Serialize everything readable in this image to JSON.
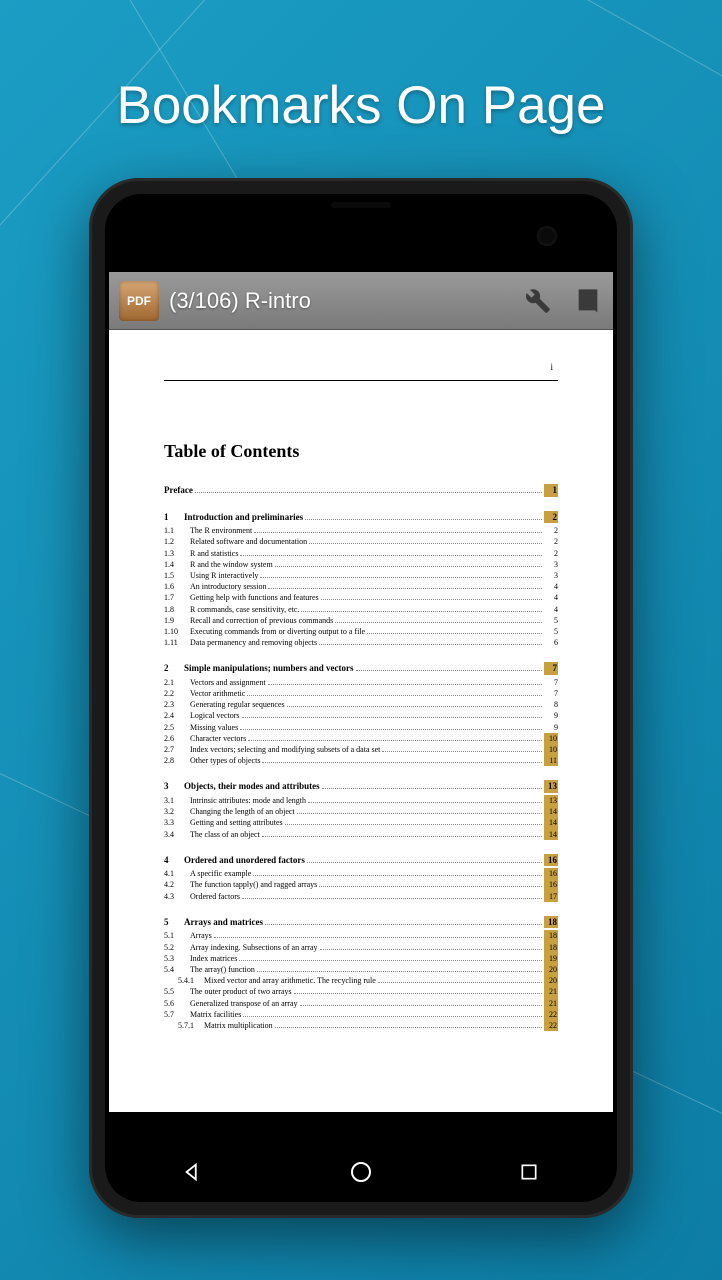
{
  "headline": "Bookmarks On Page",
  "appbar": {
    "pdf_label": "PDF",
    "title": "(3/106) R-intro"
  },
  "page_marker": "i",
  "toc": {
    "title": "Table of Contents",
    "preface": {
      "label": "Preface",
      "page": "1"
    },
    "chapters": [
      {
        "num": "1",
        "title": "Introduction and preliminaries",
        "page": "2",
        "hl": true,
        "subs": [
          {
            "num": "1.1",
            "title": "The R environment",
            "page": "2"
          },
          {
            "num": "1.2",
            "title": "Related software and documentation",
            "page": "2"
          },
          {
            "num": "1.3",
            "title": "R and statistics",
            "page": "2"
          },
          {
            "num": "1.4",
            "title": "R and the window system",
            "page": "3"
          },
          {
            "num": "1.5",
            "title": "Using R interactively",
            "page": "3"
          },
          {
            "num": "1.6",
            "title": "An introductory session",
            "page": "4"
          },
          {
            "num": "1.7",
            "title": "Getting help with functions and features",
            "page": "4"
          },
          {
            "num": "1.8",
            "title": "R commands, case sensitivity, etc.",
            "page": "4"
          },
          {
            "num": "1.9",
            "title": "Recall and correction of previous commands",
            "page": "5"
          },
          {
            "num": "1.10",
            "title": "Executing commands from or diverting output to a file",
            "page": "5"
          },
          {
            "num": "1.11",
            "title": "Data permanency and removing objects",
            "page": "6"
          }
        ]
      },
      {
        "num": "2",
        "title": "Simple manipulations; numbers and vectors",
        "page": "7",
        "hl": true,
        "subs": [
          {
            "num": "2.1",
            "title": "Vectors and assignment",
            "page": "7"
          },
          {
            "num": "2.2",
            "title": "Vector arithmetic",
            "page": "7"
          },
          {
            "num": "2.3",
            "title": "Generating regular sequences",
            "page": "8"
          },
          {
            "num": "2.4",
            "title": "Logical vectors",
            "page": "9"
          },
          {
            "num": "2.5",
            "title": "Missing values",
            "page": "9"
          },
          {
            "num": "2.6",
            "title": "Character vectors",
            "page": "10",
            "hl": true
          },
          {
            "num": "2.7",
            "title": "Index vectors; selecting and modifying subsets of a data set",
            "page": "10",
            "hl": true
          },
          {
            "num": "2.8",
            "title": "Other types of objects",
            "page": "11",
            "hl": true
          }
        ]
      },
      {
        "num": "3",
        "title": "Objects, their modes and attributes",
        "page": "13",
        "hl": true,
        "subs": [
          {
            "num": "3.1",
            "title": "Intrinsic attributes: mode and length",
            "page": "13",
            "hl": true
          },
          {
            "num": "3.2",
            "title": "Changing the length of an object",
            "page": "14",
            "hl": true
          },
          {
            "num": "3.3",
            "title": "Getting and setting attributes",
            "page": "14",
            "hl": true
          },
          {
            "num": "3.4",
            "title": "The class of an object",
            "page": "14",
            "hl": true
          }
        ]
      },
      {
        "num": "4",
        "title": "Ordered and unordered factors",
        "page": "16",
        "hl": true,
        "subs": [
          {
            "num": "4.1",
            "title": "A specific example",
            "page": "16",
            "hl": true
          },
          {
            "num": "4.2",
            "title": "The function tapply() and ragged arrays",
            "page": "16",
            "hl": true
          },
          {
            "num": "4.3",
            "title": "Ordered factors",
            "page": "17",
            "hl": true
          }
        ]
      },
      {
        "num": "5",
        "title": "Arrays and matrices",
        "page": "18",
        "hl": true,
        "subs": [
          {
            "num": "5.1",
            "title": "Arrays",
            "page": "18",
            "hl": true
          },
          {
            "num": "5.2",
            "title": "Array indexing. Subsections of an array",
            "page": "18",
            "hl": true
          },
          {
            "num": "5.3",
            "title": "Index matrices",
            "page": "19",
            "hl": true
          },
          {
            "num": "5.4",
            "title": "The array() function",
            "page": "20",
            "hl": true,
            "subs": [
              {
                "num": "5.4.1",
                "title": "Mixed vector and array arithmetic. The recycling rule",
                "page": "20",
                "hl": true
              }
            ]
          },
          {
            "num": "5.5",
            "title": "The outer product of two arrays",
            "page": "21",
            "hl": true
          },
          {
            "num": "5.6",
            "title": "Generalized transpose of an array",
            "page": "21",
            "hl": true
          },
          {
            "num": "5.7",
            "title": "Matrix facilities",
            "page": "22",
            "hl": true,
            "subs": [
              {
                "num": "5.7.1",
                "title": "Matrix multiplication",
                "page": "22",
                "hl": true
              }
            ]
          }
        ]
      }
    ]
  }
}
